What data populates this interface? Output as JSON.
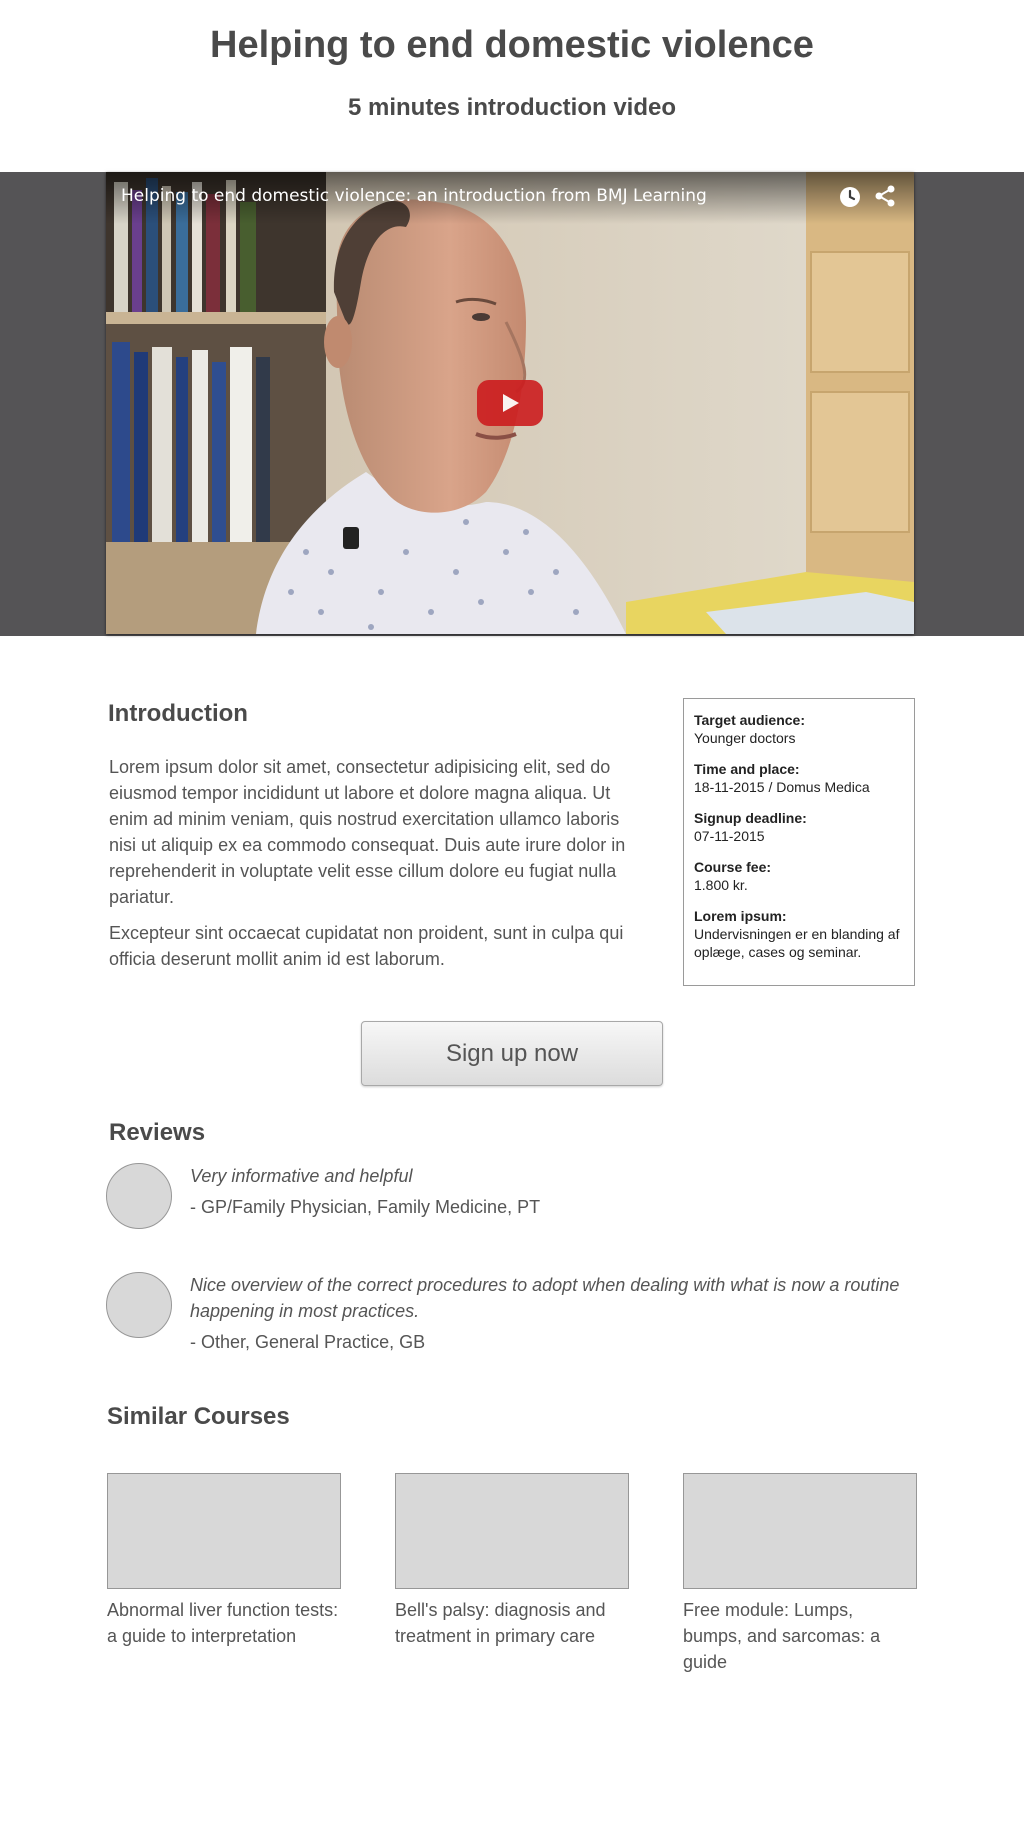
{
  "header": {
    "title": "Helping to end domestic violence",
    "subtitle": "5 minutes introduction video"
  },
  "video": {
    "title": "Helping to end domestic violence: an introduction from BMJ Learning",
    "icons": [
      "watch-later-icon",
      "share-icon",
      "play-icon"
    ],
    "play_color": "#cc1d1f"
  },
  "introduction": {
    "heading": "Introduction",
    "paragraphs": [
      "Lorem ipsum dolor sit amet, consectetur adipisicing elit, sed do eiusmod tempor incididunt ut labore et dolore magna aliqua. Ut enim ad minim veniam, quis nostrud exercitation ullamco laboris nisi ut aliquip ex ea commodo consequat. Duis aute irure dolor in reprehenderit in voluptate velit esse cillum dolore eu fugiat nulla pariatur.",
      "Excepteur sint occaecat cupidatat non proident, sunt in culpa qui officia deserunt mollit anim id est laborum."
    ]
  },
  "info": [
    {
      "label": "Target audience:",
      "value": "Younger doctors"
    },
    {
      "label": "Time and place:",
      "value": "18-11-2015 / Domus Medica"
    },
    {
      "label": "Signup deadline:",
      "value": "07-11-2015"
    },
    {
      "label": "Course fee:",
      "value": "1.800 kr."
    },
    {
      "label": "Lorem ipsum:",
      "value": "Undervisningen er en blanding af oplæge, cases og seminar."
    }
  ],
  "signup": {
    "label": "Sign up now"
  },
  "reviews": {
    "heading": "Reviews",
    "items": [
      {
        "quote": "Very informative and helpful",
        "author": "- GP/Family Physician, Family Medicine, PT"
      },
      {
        "quote": "Nice overview of the correct procedures to adopt when dealing with what is now a routine happening in most practices.",
        "author": "- Other, General Practice, GB"
      }
    ]
  },
  "similar": {
    "heading": "Similar Courses",
    "items": [
      {
        "title": "Abnormal liver function tests: a guide to interpretation"
      },
      {
        "title": "Bell's palsy: diagnosis and treatment in primary care"
      },
      {
        "title": "Free module: Lumps, bumps, and sarcomas: a guide"
      }
    ]
  }
}
